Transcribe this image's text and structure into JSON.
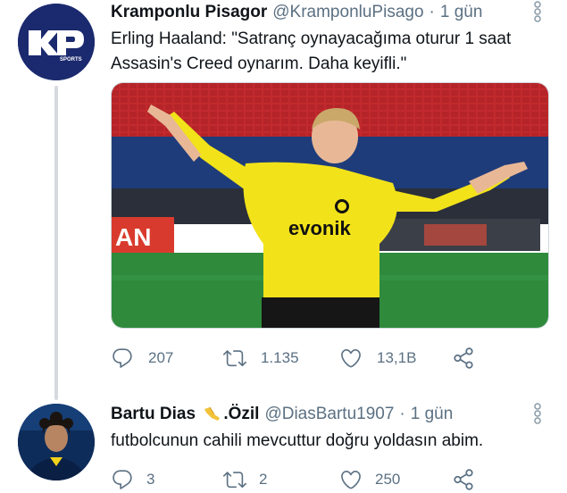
{
  "tweets": [
    {
      "display_name": "Kramponlu Pisagor",
      "handle": "@KramponluPisago",
      "separator": "·",
      "time": "1 gün",
      "text": "Erling Haaland: \"Satranç oynayacağıma oturur 1 saat Assasin's Creed oynarım. Daha keyifli.\"",
      "avatar_icon": "kramponlu-sports-logo",
      "has_media": true,
      "stats": {
        "replies": "207",
        "retweets": "1.135",
        "likes": "13,1B"
      }
    },
    {
      "display_name_part1": "Bartu Dias",
      "display_name_part2": ".Özil",
      "handle": "@DiasBartu1907",
      "separator": "·",
      "time": "1 gün",
      "text": "futbolcunun cahili mevcuttur doğru yoldasın abim.",
      "avatar_icon": "profile-photo",
      "name_emoji": "raised-hand-emoji",
      "stats": {
        "replies": "3",
        "retweets": "2",
        "likes": "250"
      }
    }
  ],
  "colors": {
    "text": "#0f1419",
    "secondary": "#5b7083",
    "thread_line": "#d6dade",
    "kit_yellow": "#f2e21a"
  },
  "logo_text": "SPORTS",
  "shirt_sponsor": "evonik"
}
